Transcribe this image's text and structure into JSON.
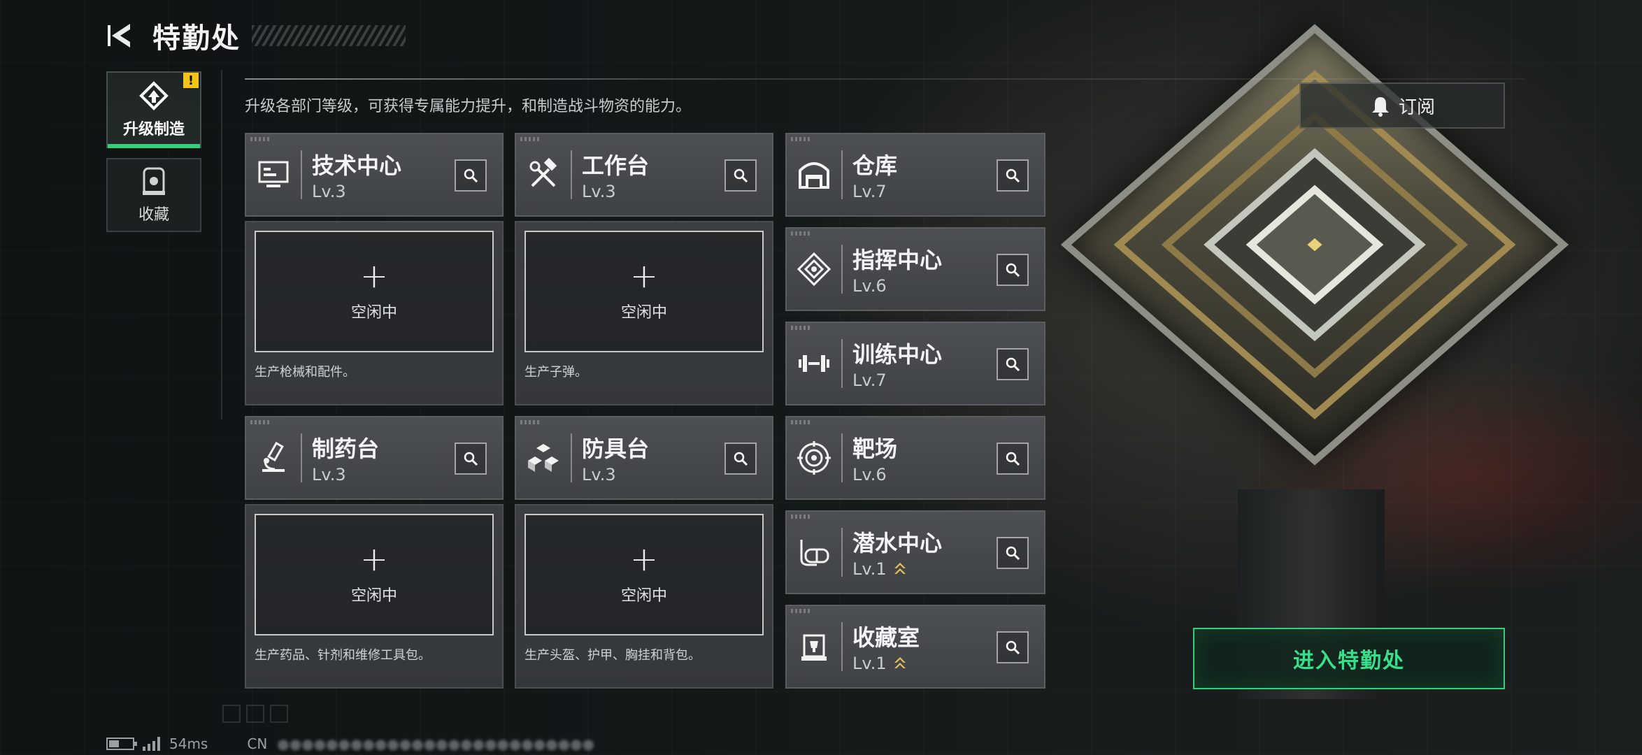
{
  "header": {
    "title": "特勤处"
  },
  "tabs": [
    {
      "label": "升级制造",
      "active": true,
      "alert": "!"
    },
    {
      "label": "收藏",
      "active": false
    }
  ],
  "description": "升级各部门等级，可获得专属能力提升，和制造战斗物资的能力。",
  "subscribe_label": "订阅",
  "enter_label": "进入特勤处",
  "production_cards": [
    {
      "name": "技术中心",
      "level": "Lv.3",
      "icon": "monitor-icon",
      "slot_status": "空闲中",
      "production_desc": "生产枪械和配件。"
    },
    {
      "name": "工作台",
      "level": "Lv.3",
      "icon": "hammer-wrench-icon",
      "slot_status": "空闲中",
      "production_desc": "生产子弹。"
    },
    {
      "name": "制药台",
      "level": "Lv.3",
      "icon": "microscope-icon",
      "slot_status": "空闲中",
      "production_desc": "生产药品、针剂和维修工具包。"
    },
    {
      "name": "防具台",
      "level": "Lv.3",
      "icon": "cubes-icon",
      "slot_status": "空闲中",
      "production_desc": "生产头盔、护甲、胸挂和背包。"
    }
  ],
  "facility_cards": [
    {
      "name": "仓库",
      "level": "Lv.7",
      "icon": "warehouse-icon",
      "upgradable": false
    },
    {
      "name": "指挥中心",
      "level": "Lv.6",
      "icon": "chip-icon",
      "upgradable": false
    },
    {
      "name": "训练中心",
      "level": "Lv.7",
      "icon": "dumbbell-icon",
      "upgradable": false
    },
    {
      "name": "靶场",
      "level": "Lv.6",
      "icon": "target-icon",
      "upgradable": false
    },
    {
      "name": "潜水中心",
      "level": "Lv.1",
      "icon": "diving-mask-icon",
      "upgradable": true
    },
    {
      "name": "收藏室",
      "level": "Lv.1",
      "icon": "trophy-cabinet-icon",
      "upgradable": true
    }
  ],
  "footer": {
    "ping": "54ms",
    "region": "CN"
  },
  "colors": {
    "accent": "#33d07a",
    "alert": "#f3c519",
    "upgrade_arrow": "#e8c25a"
  }
}
